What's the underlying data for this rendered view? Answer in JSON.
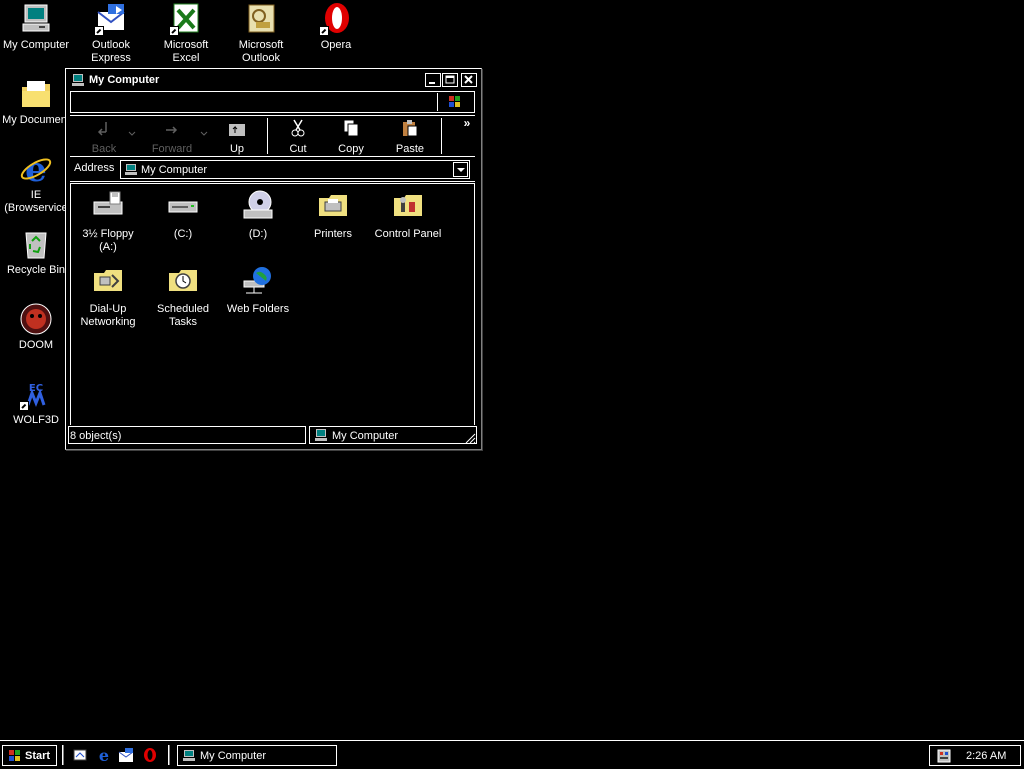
{
  "desktop": {
    "icons": [
      {
        "label": "My Computer",
        "icon": "my-computer-icon"
      },
      {
        "label": "Outlook Express",
        "label_lines": [
          "Outlook",
          "Express"
        ],
        "icon": "outlook-express-icon",
        "shortcut": true
      },
      {
        "label": "Microsoft Excel",
        "label_lines": [
          "Microsoft",
          "Excel"
        ],
        "icon": "excel-icon",
        "shortcut": true
      },
      {
        "label": "Microsoft Outlook",
        "label_lines": [
          "Microsoft",
          "Outlook"
        ],
        "icon": "outlook-icon"
      },
      {
        "label": "Opera",
        "icon": "opera-icon",
        "shortcut": true
      },
      {
        "label": "My Documents",
        "display": "My Document",
        "icon": "my-documents-icon"
      },
      {
        "label": "IE (Browservice)",
        "label_lines": [
          "IE",
          "(Browservice"
        ],
        "icon": "internet-explorer-icon"
      },
      {
        "label": "Recycle Bin",
        "icon": "recycle-bin-icon"
      },
      {
        "label": "DOOM",
        "icon": "doom-icon"
      },
      {
        "label": "WOLF3D",
        "icon": "wolf3d-icon",
        "shortcut": true
      }
    ]
  },
  "window": {
    "title": "My Computer",
    "toolbar": {
      "back": "Back",
      "forward": "Forward",
      "up": "Up",
      "cut": "Cut",
      "copy": "Copy",
      "paste": "Paste",
      "more": "»"
    },
    "address": {
      "label": "Address",
      "value": "My Computer"
    },
    "items": [
      {
        "label_lines": [
          "3½ Floppy",
          "(A:)"
        ],
        "icon": "floppy-drive-icon"
      },
      {
        "label_lines": [
          "(C:)",
          ""
        ],
        "icon": "hard-drive-icon"
      },
      {
        "label_lines": [
          "(D:)",
          ""
        ],
        "icon": "cd-drive-icon"
      },
      {
        "label_lines": [
          "Printers",
          ""
        ],
        "icon": "printers-folder-icon"
      },
      {
        "label_lines": [
          "Control Panel",
          ""
        ],
        "icon": "control-panel-icon"
      },
      {
        "label_lines": [
          "Dial-Up",
          "Networking"
        ],
        "icon": "dialup-networking-icon"
      },
      {
        "label_lines": [
          "Scheduled",
          "Tasks"
        ],
        "icon": "scheduled-tasks-icon"
      },
      {
        "label_lines": [
          "Web Folders",
          ""
        ],
        "icon": "web-folders-icon"
      }
    ],
    "status": {
      "count": "8 object(s)",
      "location": "My Computer"
    }
  },
  "taskbar": {
    "start": "Start",
    "task": "My Computer",
    "clock": "2:26 AM"
  },
  "colors": {
    "background": "#000000",
    "text": "#ffffff",
    "disabled": "#606060",
    "folder": "#f0e080",
    "opera_red": "#e00000",
    "ie_blue": "#1e5fd8"
  }
}
